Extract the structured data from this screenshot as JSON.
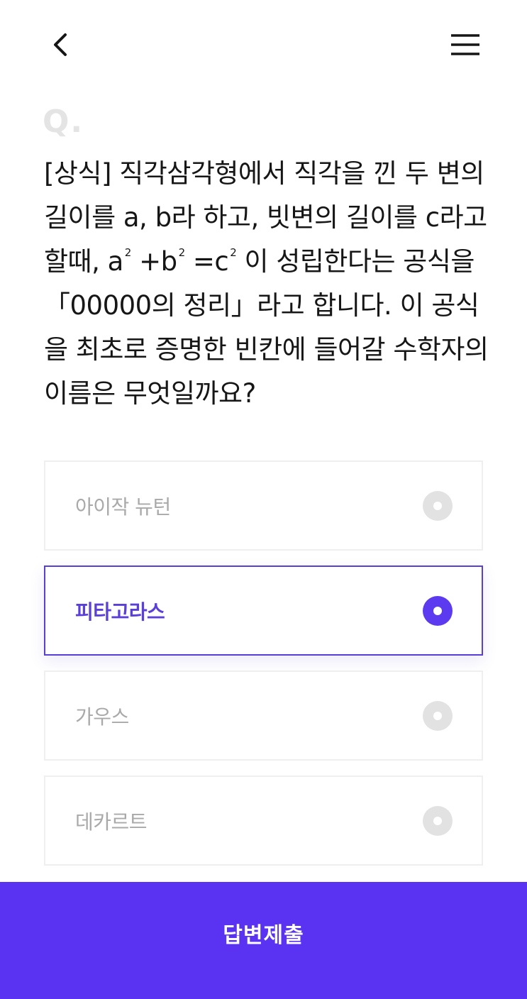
{
  "header": {
    "back_icon": "chevron-left-icon",
    "menu_icon": "hamburger-menu-icon"
  },
  "question": {
    "prefix": "Q.",
    "text_part1": "[상식] 직각삼각형에서 직각을 낀 두 변의 길이를 a, b라 하고, 빗변의 길이를 c라고 할때, a",
    "sup1": "2",
    "text_part2": " +b",
    "sup2": "2",
    "text_part3": " =c",
    "sup3": "2",
    "text_part4": " 이 성립한다는 공식을 「00000의 정리」라고 합니다. 이 공식을 최초로 증명한 빈칸에 들어갈 수학자의 이름은 무엇일까요?"
  },
  "options": [
    {
      "label": "아이작 뉴턴",
      "selected": false
    },
    {
      "label": "피타고라스",
      "selected": true
    },
    {
      "label": "가우스",
      "selected": false
    },
    {
      "label": "데카르트",
      "selected": false
    }
  ],
  "submit": {
    "label": "답변제출"
  },
  "colors": {
    "accent": "#5a32f2",
    "selected_text": "#5b3fd9",
    "unselected_text": "#a9a9a9",
    "radio_off": "#e2e2e2"
  }
}
